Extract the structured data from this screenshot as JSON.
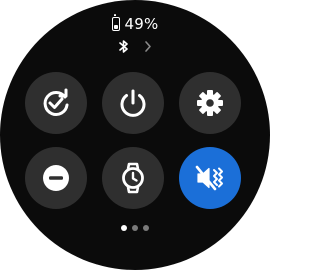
{
  "status": {
    "battery_percent_label": "49%",
    "battery_level": 0.49,
    "bluetooth_icon": "bluetooth-icon",
    "more_icon": "chevron-right-icon"
  },
  "tiles": [
    {
      "name": "sync-check",
      "icon": "sync-check-icon",
      "active": false
    },
    {
      "name": "power",
      "icon": "power-icon",
      "active": false
    },
    {
      "name": "settings",
      "icon": "gear-icon",
      "active": false
    },
    {
      "name": "do-not-disturb",
      "icon": "do-not-disturb-icon",
      "active": false
    },
    {
      "name": "watch-only",
      "icon": "watch-icon",
      "active": false
    },
    {
      "name": "sound-mute-vibrate",
      "icon": "mute-vibrate-icon",
      "active": true
    }
  ],
  "colors": {
    "background": "#0b0b0b",
    "tile": "#2f2f2f",
    "active_tile": "#1b6fd8",
    "icon": "#ffffff"
  },
  "pagination": {
    "current_page": 1,
    "total_pages": 3
  }
}
